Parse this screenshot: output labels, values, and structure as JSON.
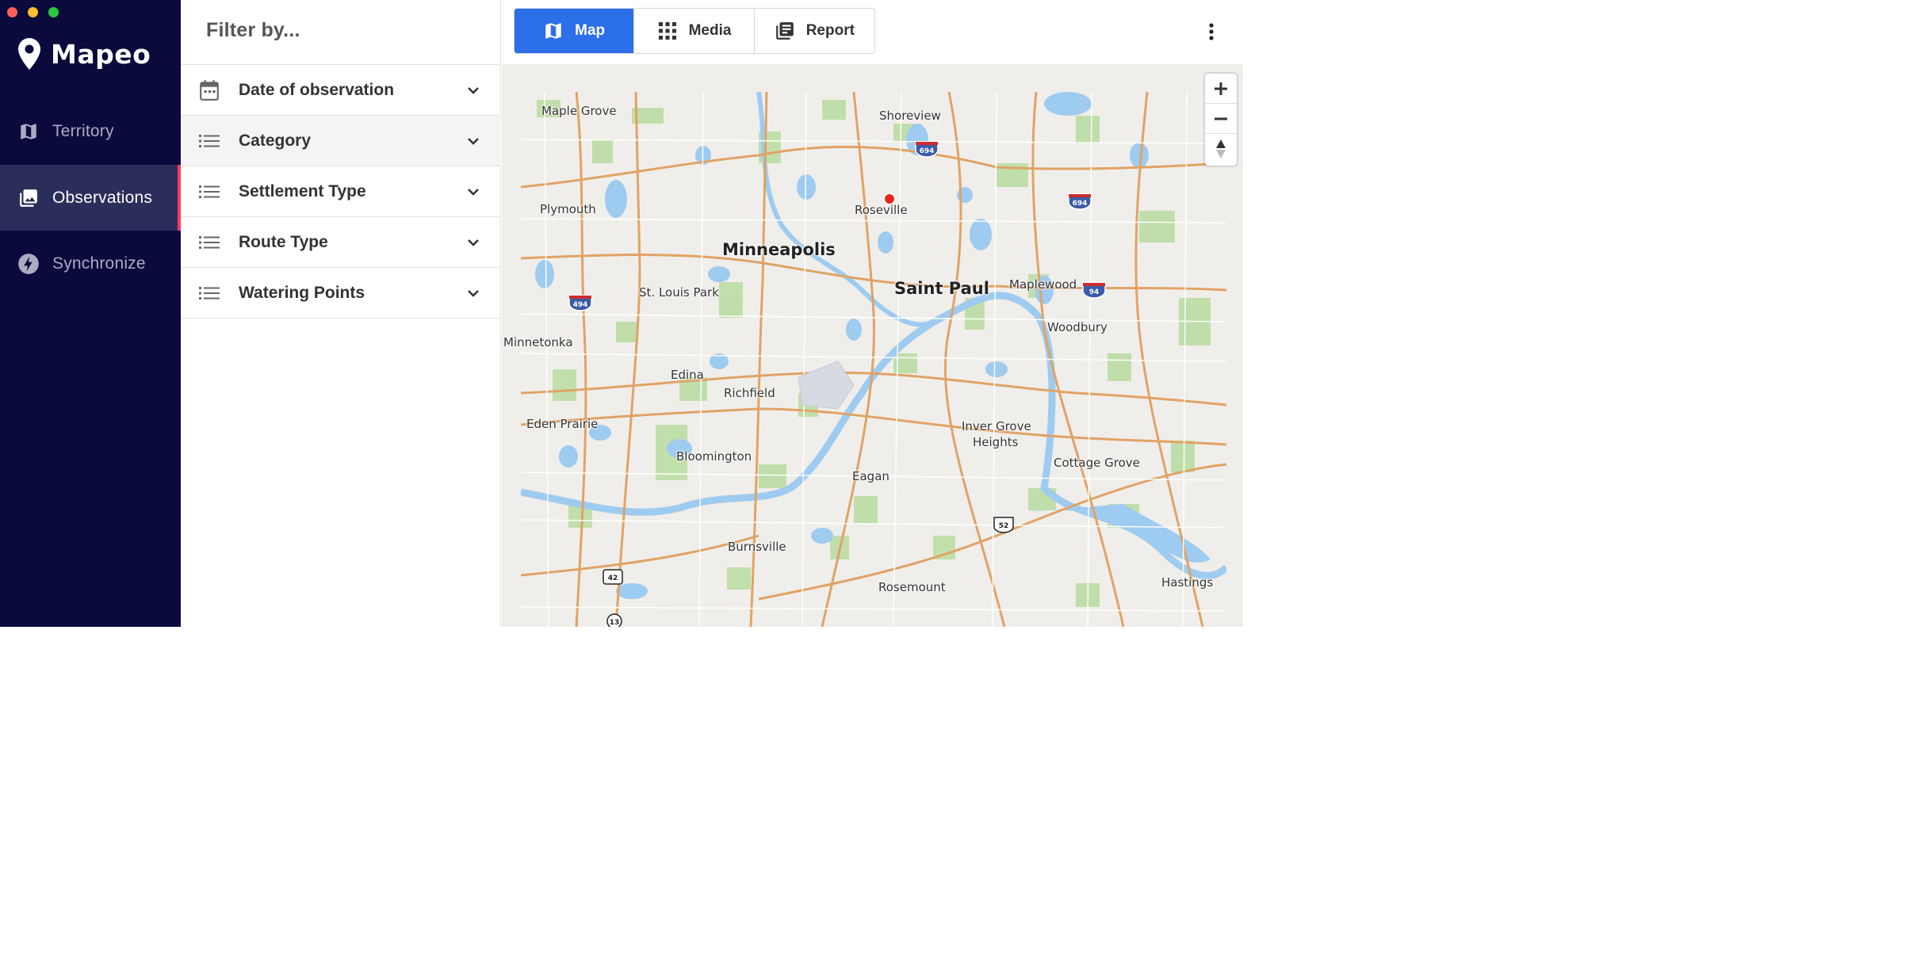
{
  "app": {
    "name": "Mapeo"
  },
  "sidebar": {
    "items": [
      {
        "label": "Territory",
        "icon": "map-icon",
        "active": false
      },
      {
        "label": "Observations",
        "icon": "photo-library-icon",
        "active": true
      },
      {
        "label": "Synchronize",
        "icon": "flash-icon",
        "active": false
      }
    ]
  },
  "filters": {
    "title": "Filter by...",
    "items": [
      {
        "label": "Date of observation",
        "icon": "calendar-icon"
      },
      {
        "label": "Category",
        "icon": "list-icon"
      },
      {
        "label": "Settlement Type",
        "icon": "list-icon"
      },
      {
        "label": "Route Type",
        "icon": "list-icon"
      },
      {
        "label": "Watering Points",
        "icon": "list-icon"
      }
    ]
  },
  "view_tabs": [
    {
      "label": "Map",
      "icon": "map-icon",
      "active": true
    },
    {
      "label": "Media",
      "icon": "grid-icon",
      "active": false
    },
    {
      "label": "Report",
      "icon": "report-icon",
      "active": false
    }
  ],
  "map": {
    "places": [
      {
        "name": "Maple Grove",
        "size": "small"
      },
      {
        "name": "Shoreview",
        "size": "small"
      },
      {
        "name": "Plymouth",
        "size": "small"
      },
      {
        "name": "Roseville",
        "size": "small"
      },
      {
        "name": "Minneapolis",
        "size": "big"
      },
      {
        "name": "Saint Paul",
        "size": "big"
      },
      {
        "name": "Maplewood",
        "size": "small"
      },
      {
        "name": "St. Louis Park",
        "size": "small"
      },
      {
        "name": "Woodbury",
        "size": "small"
      },
      {
        "name": "Minnetonka",
        "size": "small"
      },
      {
        "name": "Edina",
        "size": "small"
      },
      {
        "name": "Richfield",
        "size": "small"
      },
      {
        "name": "Eden Prairie",
        "size": "small"
      },
      {
        "name": "Inver Grove",
        "size": "small"
      },
      {
        "name": "Heights",
        "size": "small"
      },
      {
        "name": "Bloomington",
        "size": "small"
      },
      {
        "name": "Cottage Grove",
        "size": "small"
      },
      {
        "name": "Eagan",
        "size": "small"
      },
      {
        "name": "Burnsville",
        "size": "small"
      },
      {
        "name": "Rosemount",
        "size": "small"
      },
      {
        "name": "Hastings",
        "size": "small"
      }
    ],
    "shields": [
      {
        "number": "694",
        "type": "interstate"
      },
      {
        "number": "694",
        "type": "interstate"
      },
      {
        "number": "494",
        "type": "interstate"
      },
      {
        "number": "94",
        "type": "interstate"
      },
      {
        "number": "52",
        "type": "us"
      },
      {
        "number": "42",
        "type": "county"
      },
      {
        "number": "13",
        "type": "us"
      }
    ],
    "zoom": {
      "in_label": "+",
      "out_label": "−"
    },
    "colors": {
      "water": "#9ecbf0",
      "road": "#e0a366",
      "park": "#b8dca0",
      "land": "#f0eeea",
      "marker": "#e8261d"
    }
  }
}
